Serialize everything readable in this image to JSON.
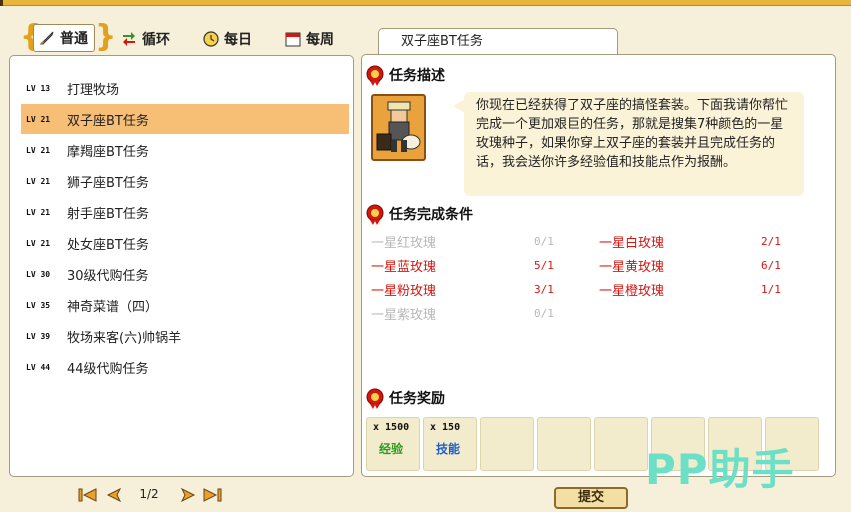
{
  "tabs": [
    {
      "label": "普通",
      "icon": "sword-icon",
      "active": true
    },
    {
      "label": "循环",
      "icon": "cycle-arrows-icon",
      "active": false
    },
    {
      "label": "每日",
      "icon": "clock-icon",
      "active": false
    },
    {
      "label": "每周",
      "icon": "calendar-icon",
      "active": false
    }
  ],
  "quests": [
    {
      "level": "LV 13",
      "name": "打理牧场"
    },
    {
      "level": "LV 21",
      "name": "双子座BT任务"
    },
    {
      "level": "LV 21",
      "name": "摩羯座BT任务"
    },
    {
      "level": "LV 21",
      "name": "狮子座BT任务"
    },
    {
      "level": "LV 21",
      "name": "射手座BT任务"
    },
    {
      "level": "LV 21",
      "name": "处女座BT任务"
    },
    {
      "level": "LV 30",
      "name": "30级代购任务"
    },
    {
      "level": "LV 35",
      "name": "神奇菜谱（四）"
    },
    {
      "level": "LV 39",
      "name": "牧场来客(六)帅锅羊"
    },
    {
      "level": "LV 44",
      "name": "44级代购任务"
    }
  ],
  "pager": {
    "label": "1/2"
  },
  "detail": {
    "title": "双子座BT任务",
    "desc_heading": "任务描述",
    "description": "你现在已经获得了双子座的搞怪套装。下面我请你帮忙完成一个更加艰巨的任务，那就是搜集7种颜色的一星玫瑰种子，如果你穿上双子座的套装并且完成任务的话，我会送你许多经验值和技能点作为报酬。",
    "cond_heading": "任务完成条件",
    "conditions": [
      {
        "name": "一星红玫瑰",
        "count": "0/1",
        "status": "done"
      },
      {
        "name": "一星白玫瑰",
        "count": "2/1",
        "status": "todo"
      },
      {
        "name": "一星蓝玫瑰",
        "count": "5/1",
        "status": "todo"
      },
      {
        "name": "一星黄玫瑰",
        "count": "6/1",
        "status": "todo"
      },
      {
        "name": "一星粉玫瑰",
        "count": "3/1",
        "status": "todo"
      },
      {
        "name": "一星橙玫瑰",
        "count": "1/1",
        "status": "todo"
      },
      {
        "name": "一星紫玫瑰",
        "count": "0/1",
        "status": "done"
      }
    ],
    "reward_heading": "任务奖励",
    "rewards": [
      {
        "qty": "x 1500",
        "label": "经验",
        "color": "#2f9a1e"
      },
      {
        "qty": "x 150",
        "label": "技能",
        "color": "#1e5ec8"
      }
    ]
  },
  "submit_label": "提交",
  "watermark": "PP助手",
  "colors": {
    "selected_row": "#f7be76",
    "todo_text": "#d3160e",
    "done_text": "#b8b8b8",
    "panel_border": "#a49a7c"
  }
}
